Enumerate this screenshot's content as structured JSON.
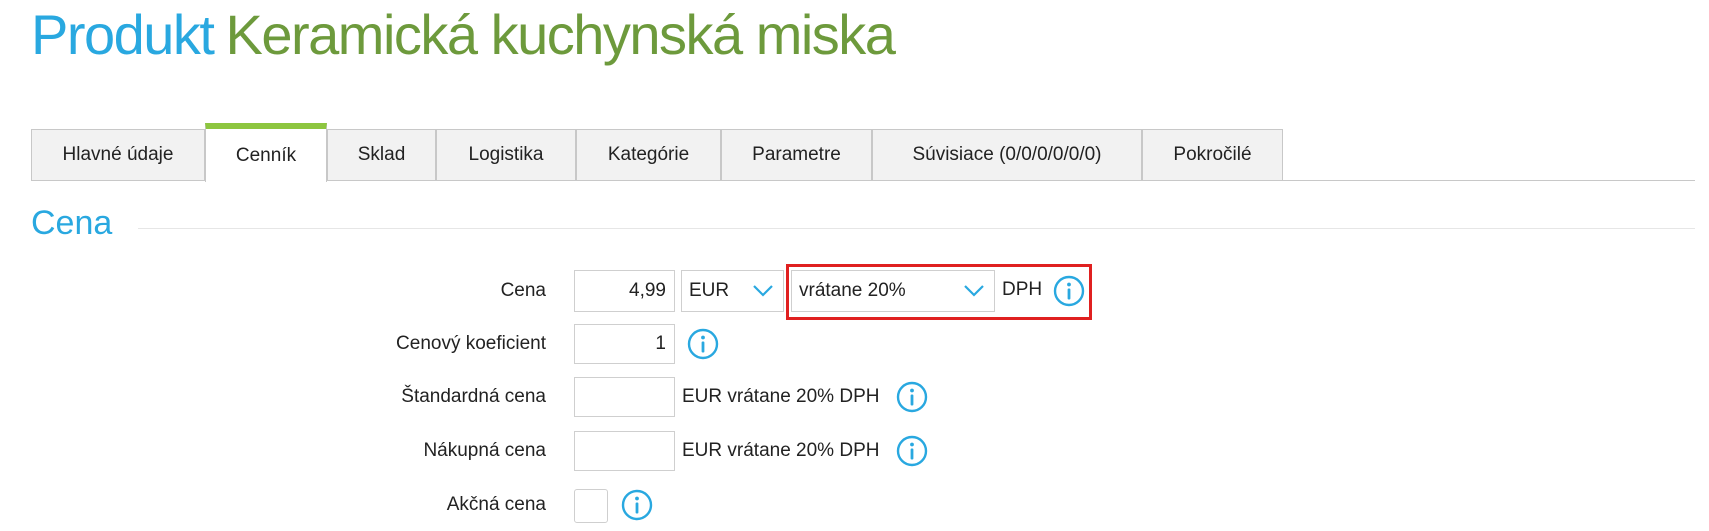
{
  "header": {
    "title_prefix": "Produkt",
    "title_name": "Keramická kuchynská miska"
  },
  "tabs": [
    {
      "label": "Hlavné údaje",
      "active": false
    },
    {
      "label": "Cenník",
      "active": true
    },
    {
      "label": "Sklad",
      "active": false
    },
    {
      "label": "Logistika",
      "active": false
    },
    {
      "label": "Kategórie",
      "active": false
    },
    {
      "label": "Parametre",
      "active": false
    },
    {
      "label": "Súvisiace (0/0/0/0/0/0)",
      "active": false
    },
    {
      "label": "Pokročilé",
      "active": false
    }
  ],
  "section": {
    "title": "Cena"
  },
  "form": {
    "price": {
      "label": "Cena",
      "value": "4,99",
      "currency": "EUR",
      "vat_option": "vrátane 20%",
      "vat_suffix": "DPH"
    },
    "coefficient": {
      "label": "Cenový koeficient",
      "value": "1"
    },
    "standard_price": {
      "label": "Štandardná cena",
      "value": "",
      "unit": "EUR vrátane 20% DPH"
    },
    "purchase_price": {
      "label": "Nákupná cena",
      "value": "",
      "unit": "EUR vrátane 20% DPH"
    },
    "sale_price": {
      "label": "Akčná cena",
      "checked": false
    }
  },
  "icons": {
    "info": "info-circle-icon",
    "dropdown": "chevron-down-icon"
  },
  "colors": {
    "title_blue": "#29a8e0",
    "title_green": "#6d9a3c",
    "active_tab_accent": "#8dc63f",
    "highlight_red": "#e02020"
  }
}
